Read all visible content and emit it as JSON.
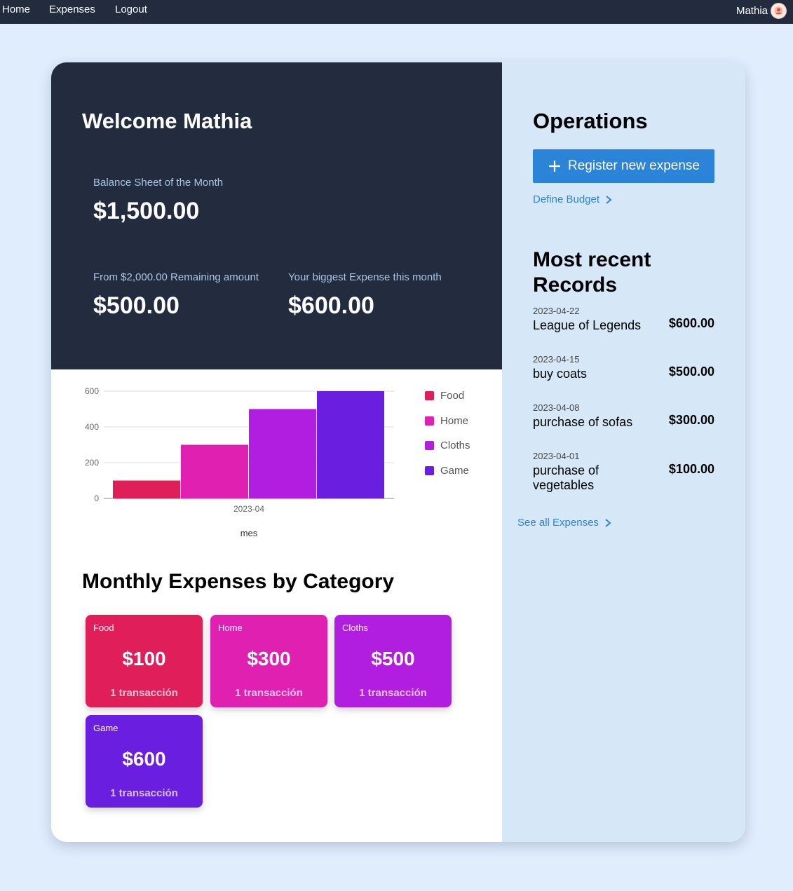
{
  "nav": {
    "home": "Home",
    "expenses": "Expenses",
    "logout": "Logout",
    "user_name": "Mathia",
    "avatar_icon": "user-avatar-icon"
  },
  "dashboard": {
    "welcome": "Welcome Mathia",
    "balance_label": "Balance Sheet of the Month",
    "balance_value": "$1,500.00",
    "remaining_label": "From $2,000.00 Remaining amount",
    "remaining_value": "$500.00",
    "biggest_label": "Your biggest Expense this month",
    "biggest_value": "$600.00"
  },
  "chart_data": {
    "type": "bar",
    "categories": [
      "2023-04"
    ],
    "series": [
      {
        "name": "Food",
        "values": [
          100
        ],
        "color": "#e01e5a"
      },
      {
        "name": "Home",
        "values": [
          300
        ],
        "color": "#e020b0"
      },
      {
        "name": "Cloths",
        "values": [
          500
        ],
        "color": "#b21ee0"
      },
      {
        "name": "Game",
        "values": [
          600
        ],
        "color": "#6a1ee0"
      }
    ],
    "xlabel": "mes",
    "ylabel": "",
    "ylim": [
      0,
      600
    ],
    "yticks": [
      "0",
      "200",
      "400",
      "600"
    ],
    "grid": true,
    "legend": "right"
  },
  "categories_section": {
    "title": "Monthly Expenses by Category",
    "items": [
      {
        "name": "Food",
        "amount": "$100",
        "count": "1 transacción",
        "color": "#e01e5a"
      },
      {
        "name": "Home",
        "amount": "$300",
        "count": "1 transacción",
        "color": "#e020b0"
      },
      {
        "name": "Cloths",
        "amount": "$500",
        "count": "1 transacción",
        "color": "#b21ee0"
      },
      {
        "name": "Game",
        "amount": "$600",
        "count": "1 transacción",
        "color": "#6a1ee0"
      }
    ]
  },
  "operations": {
    "title": "Operations",
    "register_label": "Register new expense",
    "register_icon": "plus-icon",
    "budget_label": "Define Budget",
    "budget_icon": "chevron-right-icon"
  },
  "recent": {
    "title": "Most recent Records",
    "records": [
      {
        "date": "2023-04-22",
        "desc": "League of Legends",
        "amount": "$600.00"
      },
      {
        "date": "2023-04-15",
        "desc": "buy coats",
        "amount": "$500.00"
      },
      {
        "date": "2023-04-08",
        "desc": "purchase of sofas",
        "amount": "$300.00"
      },
      {
        "date": "2023-04-01",
        "desc": "purchase of vegetables",
        "amount": "$100.00"
      }
    ],
    "see_all_label": "See all Expenses",
    "see_all_icon": "chevron-right-icon"
  }
}
